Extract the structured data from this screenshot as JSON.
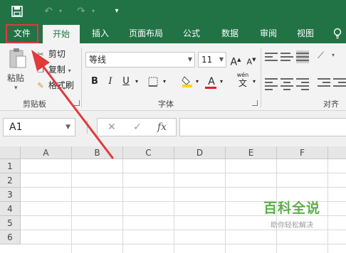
{
  "quick_access": {
    "save_icon": "save-icon",
    "undo_icon": "undo-icon",
    "redo_icon": "redo-icon",
    "customize_icon": "customize-icon"
  },
  "tabs": [
    {
      "label": "文件"
    },
    {
      "label": "开始"
    },
    {
      "label": "插入"
    },
    {
      "label": "页面布局"
    },
    {
      "label": "公式"
    },
    {
      "label": "数据"
    },
    {
      "label": "审阅"
    },
    {
      "label": "视图"
    }
  ],
  "tell_me_icon": "lightbulb-icon",
  "clipboard": {
    "paste": "粘贴",
    "cut": "剪切",
    "copy": "复制",
    "format_painter": "格式刷",
    "group_label": "剪贴板"
  },
  "font": {
    "name": "等线",
    "size": "11",
    "bold": "B",
    "italic": "I",
    "underline": "U",
    "color_letter": "A",
    "wen": "wén",
    "wen_char": "文",
    "grow": "A",
    "shrink": "A",
    "group_label": "字体"
  },
  "alignment": {
    "group_label": "对齐方"
  },
  "formula_bar": {
    "cell_ref": "A1",
    "cancel": "✕",
    "enter": "✓",
    "fx": "fx",
    "value": ""
  },
  "columns": [
    "A",
    "B",
    "C",
    "D",
    "E",
    "F"
  ],
  "rows": [
    "1",
    "2",
    "3",
    "4",
    "5",
    "6"
  ],
  "watermark": {
    "title": "百科全说",
    "subtitle": "助你轻松解决"
  },
  "colors": {
    "accent": "#217346",
    "highlight_red": "#e03a3a",
    "fill_yellow": "#ffd800",
    "font_red": "#e81b23"
  }
}
